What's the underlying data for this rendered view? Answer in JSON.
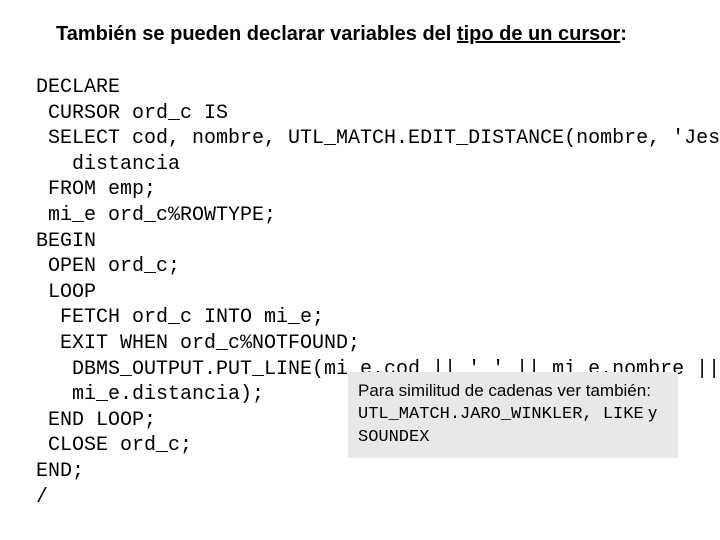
{
  "title": {
    "prefix": "También se pueden declarar variables del ",
    "underlined": "tipo de un cursor",
    "suffix": ":"
  },
  "code": {
    "l01": "DECLARE",
    "l02": " CURSOR ord_c IS",
    "l03a": " SELECT cod, nombre, UTL_MATCH.EDIT_DISTANCE(nombre, 'Jessy') AS",
    "l03b": "   distancia",
    "l04": " FROM emp;",
    "l05": " mi_e ord_c%ROWTYPE;",
    "l06": "BEGIN",
    "l07": " OPEN ord_c;",
    "l08": " LOOP",
    "l09": "  FETCH ord_c INTO mi_e;",
    "l10": "  EXIT WHEN ord_c%NOTFOUND;",
    "l11a": "   DBMS_OUTPUT.PUT_LINE(mi_e.cod || ' ' || mi_e.nombre || ' ' ||",
    "l11b": "   mi_e.distancia);",
    "l12": " END LOOP;",
    "l13": " CLOSE ord_c;",
    "l14": "END;",
    "l15": "/"
  },
  "note": {
    "line1": "Para similitud de cadenas ver también:",
    "line2_code": "UTL_MATCH.JARO_WINKLER, LIKE",
    "line2_suffix": " y",
    "line3_code": "SOUNDEX"
  }
}
